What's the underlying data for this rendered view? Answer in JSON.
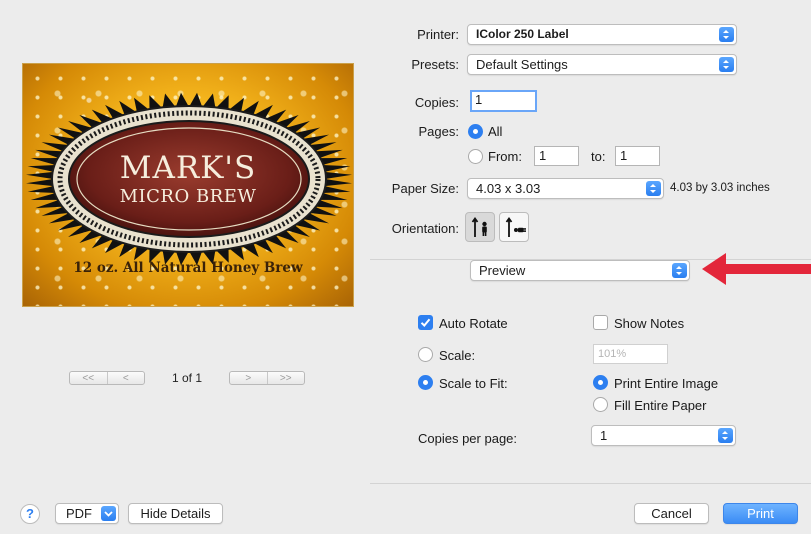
{
  "preview": {
    "brand_name": "MARK'S",
    "brand_sub": "MICRO BREW",
    "footer_text": "12 oz. All Natural Honey Brew",
    "page_indicator": "1 of 1",
    "first_label": "<<",
    "prev_label": "<",
    "next_label": ">",
    "last_label": ">>"
  },
  "form": {
    "printer_label": "Printer:",
    "printer_value": "IColor 250 Label",
    "presets_label": "Presets:",
    "presets_value": "Default Settings",
    "copies_label": "Copies:",
    "copies_value": "1",
    "pages_label": "Pages:",
    "pages_all_label": "All",
    "pages_from_label": "From:",
    "pages_from_value": "1",
    "pages_to_label": "to:",
    "pages_to_value": "1",
    "paper_size_label": "Paper Size:",
    "paper_size_value": "4.03 x 3.03",
    "paper_size_desc": "4.03 by 3.03 inches",
    "orientation_label": "Orientation:",
    "section_value": "Preview"
  },
  "preview_options": {
    "auto_rotate_label": "Auto Rotate",
    "auto_rotate_checked": true,
    "show_notes_label": "Show Notes",
    "show_notes_checked": false,
    "scale_label": "Scale:",
    "scale_value": "101%",
    "scale_to_fit_label": "Scale to Fit:",
    "print_entire_image_label": "Print Entire Image",
    "fill_entire_paper_label": "Fill Entire Paper",
    "copies_per_page_label": "Copies per page:",
    "copies_per_page_value": "1"
  },
  "footer": {
    "help_label": "?",
    "pdf_label": "PDF",
    "hide_details_label": "Hide Details",
    "cancel_label": "Cancel",
    "print_label": "Print"
  },
  "colors": {
    "accent": "#2d7ff0",
    "annotation_arrow": "#e3263a"
  }
}
